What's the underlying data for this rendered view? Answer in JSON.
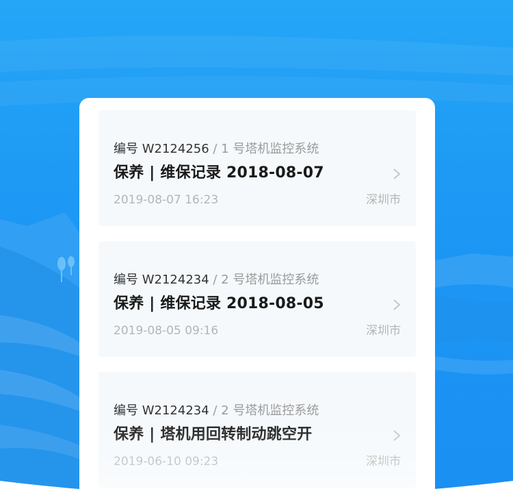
{
  "colors": {
    "background_top": "#25a6f6",
    "background_bottom": "#1a8ff3",
    "card_bg": "#f5f9fc",
    "title_text": "#1a1a1a",
    "muted_text": "#b5b5b5"
  },
  "records": [
    {
      "code_prefix": "编号 W2124256",
      "separator": "/",
      "device": "1 号塔机监控系统",
      "title": "保养 | 维保记录  2018-08-07",
      "time": "2019-08-07 16:23",
      "city": "深圳市",
      "icon": "chevron-right-icon"
    },
    {
      "code_prefix": "编号 W2124234",
      "separator": "/",
      "device": "2 号塔机监控系统",
      "title": "保养 | 维保记录  2018-08-05",
      "time": "2019-08-05 09:16",
      "city": "深圳市",
      "icon": "chevron-right-icon"
    },
    {
      "code_prefix": "编号 W2124234",
      "separator": "/",
      "device": "2 号塔机监控系统",
      "title": "保养 | 塔机用回转制动跳空开",
      "time": "2019-06-10 09:23",
      "city": "深圳市",
      "icon": "chevron-right-icon"
    }
  ]
}
